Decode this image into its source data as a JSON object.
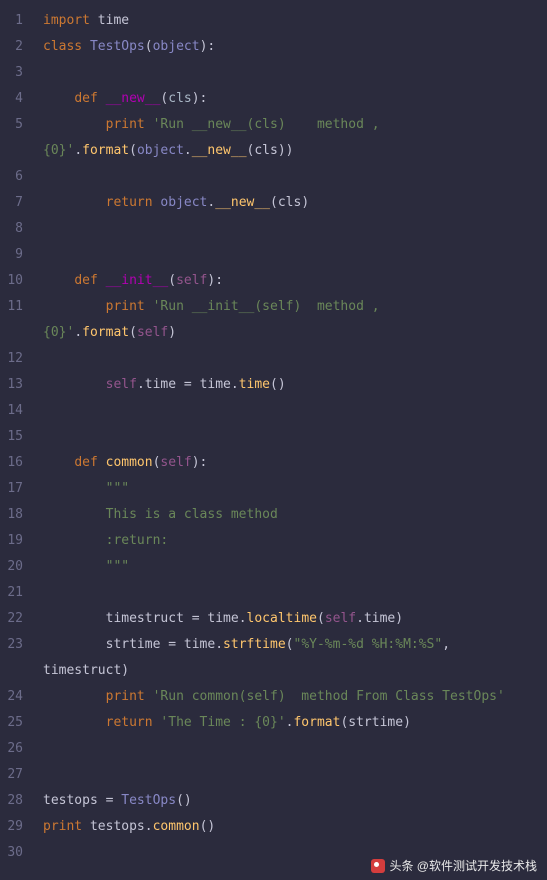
{
  "editor": {
    "language": "python",
    "line_count": 30,
    "lines": [
      {
        "n": 1,
        "tokens": [
          [
            "kw",
            "import"
          ],
          [
            "",
            ": "
          ],
          [
            "",
            "time"
          ]
        ]
      },
      {
        "n": 2,
        "tokens": [
          [
            "kw",
            "class "
          ],
          [
            "cls",
            "TestOps"
          ],
          [
            "punc",
            "("
          ],
          [
            "builtin",
            "object"
          ],
          [
            "punc",
            "):"
          ]
        ]
      },
      {
        "n": 3,
        "tokens": []
      },
      {
        "n": 4,
        "tokens": [
          [
            "",
            "    "
          ],
          [
            "kw",
            "def "
          ],
          [
            "dunder",
            "__new__"
          ],
          [
            "punc",
            "("
          ],
          [
            "param",
            "cls"
          ],
          [
            "punc",
            "):"
          ]
        ]
      },
      {
        "n": 5,
        "tokens": [
          [
            "",
            "        "
          ],
          [
            "kw",
            "print "
          ],
          [
            "str",
            "'Run __new__(cls)    method , "
          ]
        ]
      },
      {
        "n": 5.1,
        "tokens": [
          [
            "str",
            "{0}'"
          ],
          [
            "punc",
            "."
          ],
          [
            "fn",
            "format"
          ],
          [
            "punc",
            "("
          ],
          [
            "builtin",
            "object"
          ],
          [
            "punc",
            "."
          ],
          [
            "fn",
            "__new__"
          ],
          [
            "punc",
            "("
          ],
          [
            "",
            "cls"
          ],
          [
            "punc",
            "))"
          ]
        ]
      },
      {
        "n": 6,
        "tokens": []
      },
      {
        "n": 7,
        "tokens": [
          [
            "",
            "        "
          ],
          [
            "kw",
            "return "
          ],
          [
            "builtin",
            "object"
          ],
          [
            "punc",
            "."
          ],
          [
            "fn",
            "__new__"
          ],
          [
            "punc",
            "("
          ],
          [
            "",
            "cls"
          ],
          [
            "punc",
            ")"
          ]
        ]
      },
      {
        "n": 8,
        "tokens": []
      },
      {
        "n": 9,
        "tokens": []
      },
      {
        "n": 10,
        "tokens": [
          [
            "",
            "    "
          ],
          [
            "kw",
            "def "
          ],
          [
            "dunder",
            "__init__"
          ],
          [
            "punc",
            "("
          ],
          [
            "self",
            "self"
          ],
          [
            "punc",
            "):"
          ]
        ]
      },
      {
        "n": 11,
        "tokens": [
          [
            "",
            "        "
          ],
          [
            "kw",
            "print "
          ],
          [
            "str",
            "'Run __init__(self)  method , "
          ]
        ]
      },
      {
        "n": 11.1,
        "tokens": [
          [
            "str",
            "{0}'"
          ],
          [
            "punc",
            "."
          ],
          [
            "fn",
            "format"
          ],
          [
            "punc",
            "("
          ],
          [
            "self",
            "self"
          ],
          [
            "punc",
            ")"
          ]
        ]
      },
      {
        "n": 12,
        "tokens": []
      },
      {
        "n": 13,
        "tokens": [
          [
            "",
            "        "
          ],
          [
            "self",
            "self"
          ],
          [
            "punc",
            "."
          ],
          [
            "",
            "time"
          ],
          [
            "punc",
            " = "
          ],
          [
            "",
            "time"
          ],
          [
            "punc",
            "."
          ],
          [
            "fn",
            "time"
          ],
          [
            "punc",
            "()"
          ]
        ]
      },
      {
        "n": 14,
        "tokens": []
      },
      {
        "n": 15,
        "tokens": []
      },
      {
        "n": 16,
        "tokens": [
          [
            "",
            "    "
          ],
          [
            "kw",
            "def "
          ],
          [
            "decl",
            "common"
          ],
          [
            "punc",
            "("
          ],
          [
            "self",
            "self"
          ],
          [
            "punc",
            "):"
          ]
        ]
      },
      {
        "n": 17,
        "tokens": [
          [
            "",
            "        "
          ],
          [
            "str",
            "\"\"\""
          ]
        ]
      },
      {
        "n": 18,
        "tokens": [
          [
            "",
            "        "
          ],
          [
            "str",
            "This is a class method"
          ]
        ]
      },
      {
        "n": 19,
        "tokens": [
          [
            "",
            "        "
          ],
          [
            "str",
            ":return:"
          ]
        ]
      },
      {
        "n": 20,
        "tokens": [
          [
            "",
            "        "
          ],
          [
            "str",
            "\"\"\""
          ]
        ]
      },
      {
        "n": 21,
        "tokens": []
      },
      {
        "n": 22,
        "tokens": [
          [
            "",
            "        "
          ],
          [
            "",
            "timestruct"
          ],
          [
            "punc",
            " = "
          ],
          [
            "",
            "time"
          ],
          [
            "punc",
            "."
          ],
          [
            "fn",
            "localtime"
          ],
          [
            "punc",
            "("
          ],
          [
            "self",
            "self"
          ],
          [
            "punc",
            "."
          ],
          [
            "",
            "time"
          ],
          [
            "punc",
            ")"
          ]
        ]
      },
      {
        "n": 23,
        "tokens": [
          [
            "",
            "        "
          ],
          [
            "",
            "strtime"
          ],
          [
            "punc",
            " = "
          ],
          [
            "",
            "time"
          ],
          [
            "punc",
            "."
          ],
          [
            "fn",
            "strftime"
          ],
          [
            "punc",
            "("
          ],
          [
            "str",
            "\"%Y-%m-%d %H:%M:%S\""
          ],
          [
            "punc",
            ", "
          ]
        ]
      },
      {
        "n": 23.1,
        "tokens": [
          [
            "",
            "timestruct"
          ],
          [
            "punc",
            ")"
          ]
        ]
      },
      {
        "n": 24,
        "tokens": [
          [
            "",
            "        "
          ],
          [
            "kw",
            "print "
          ],
          [
            "str",
            "'Run common(self)  method From Class TestOps'"
          ]
        ]
      },
      {
        "n": 25,
        "tokens": [
          [
            "",
            "        "
          ],
          [
            "kw",
            "return "
          ],
          [
            "str",
            "'The Time : {0}'"
          ],
          [
            "punc",
            "."
          ],
          [
            "fn",
            "format"
          ],
          [
            "punc",
            "("
          ],
          [
            "",
            "strtime"
          ],
          [
            "punc",
            ")"
          ]
        ]
      },
      {
        "n": 26,
        "tokens": []
      },
      {
        "n": 27,
        "tokens": []
      },
      {
        "n": 28,
        "tokens": [
          [
            "",
            "testops"
          ],
          [
            "punc",
            " = "
          ],
          [
            "cls",
            "TestOps"
          ],
          [
            "punc",
            "()"
          ]
        ]
      },
      {
        "n": 29,
        "tokens": [
          [
            "kw",
            "print "
          ],
          [
            "",
            "testops"
          ],
          [
            "punc",
            "."
          ],
          [
            "fn",
            "common"
          ],
          [
            "punc",
            "()"
          ]
        ]
      },
      {
        "n": 30,
        "tokens": []
      }
    ]
  },
  "watermark": {
    "text": "头条 @软件测试开发技术栈"
  }
}
